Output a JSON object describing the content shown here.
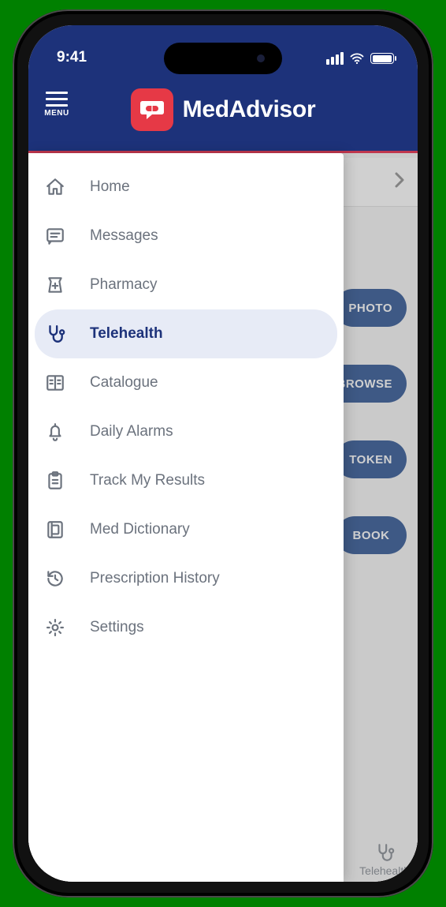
{
  "status": {
    "time": "9:41"
  },
  "header": {
    "menu_label": "MENU",
    "brand": "MedAdvisor"
  },
  "drawer": {
    "items": [
      {
        "key": "home",
        "label": "Home",
        "active": false
      },
      {
        "key": "messages",
        "label": "Messages",
        "active": false
      },
      {
        "key": "pharmacy",
        "label": "Pharmacy",
        "active": false
      },
      {
        "key": "telehealth",
        "label": "Telehealth",
        "active": true
      },
      {
        "key": "catalogue",
        "label": "Catalogue",
        "active": false
      },
      {
        "key": "daily-alarms",
        "label": "Daily Alarms",
        "active": false
      },
      {
        "key": "track-my-results",
        "label": "Track My Results",
        "active": false
      },
      {
        "key": "med-dictionary",
        "label": "Med Dictionary",
        "active": false
      },
      {
        "key": "prescription-history",
        "label": "Prescription History",
        "active": false
      },
      {
        "key": "settings",
        "label": "Settings",
        "active": false
      }
    ]
  },
  "main": {
    "action_buttons": [
      {
        "label": "PHOTO"
      },
      {
        "label": "BROWSE"
      },
      {
        "label": "TOKEN"
      },
      {
        "label": "BOOK"
      }
    ],
    "bottom_tab": {
      "label": "Telehealth"
    }
  }
}
